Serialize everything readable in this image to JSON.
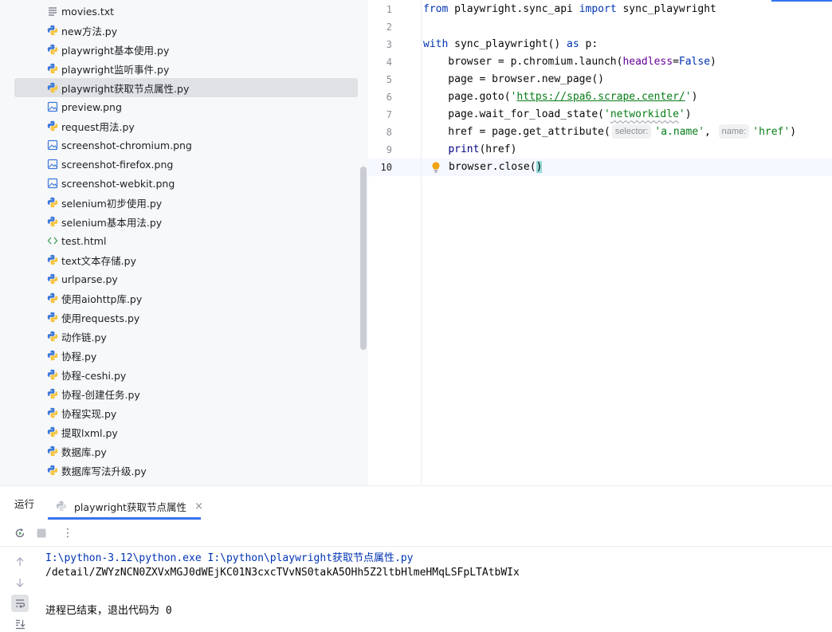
{
  "project_tree": {
    "items": [
      {
        "name": "movies.txt",
        "type": "text"
      },
      {
        "name": "new方法.py",
        "type": "python"
      },
      {
        "name": "playwright基本使用.py",
        "type": "python"
      },
      {
        "name": "playwright监听事件.py",
        "type": "python"
      },
      {
        "name": "playwright获取节点属性.py",
        "type": "python",
        "selected": true
      },
      {
        "name": "preview.png",
        "type": "image"
      },
      {
        "name": "request用法.py",
        "type": "python"
      },
      {
        "name": "screenshot-chromium.png",
        "type": "image"
      },
      {
        "name": "screenshot-firefox.png",
        "type": "image"
      },
      {
        "name": "screenshot-webkit.png",
        "type": "image"
      },
      {
        "name": "selenium初步使用.py",
        "type": "python"
      },
      {
        "name": "selenium基本用法.py",
        "type": "python"
      },
      {
        "name": "test.html",
        "type": "html"
      },
      {
        "name": "text文本存储.py",
        "type": "python"
      },
      {
        "name": "urlparse.py",
        "type": "python"
      },
      {
        "name": "使用aiohttp库.py",
        "type": "python"
      },
      {
        "name": "使用requests.py",
        "type": "python"
      },
      {
        "name": "动作链.py",
        "type": "python"
      },
      {
        "name": "协程.py",
        "type": "python"
      },
      {
        "name": "协程-ceshi.py",
        "type": "python"
      },
      {
        "name": "协程-创建任务.py",
        "type": "python"
      },
      {
        "name": "协程实现.py",
        "type": "python"
      },
      {
        "name": "提取lxml.py",
        "type": "python"
      },
      {
        "name": "数据库.py",
        "type": "python"
      },
      {
        "name": "数据库写法升级.py",
        "type": "python"
      }
    ]
  },
  "editor": {
    "current_line": 10,
    "line_numbers": [
      "1",
      "2",
      "3",
      "4",
      "5",
      "6",
      "7",
      "8",
      "9",
      "10"
    ],
    "tokens": {
      "l1_from": "from",
      "l1_module": " playwright.sync_api ",
      "l1_import": "import",
      "l1_name": " sync_playwright",
      "l3_with": "with",
      "l3_call": " sync_playwright() ",
      "l3_as": "as",
      "l3_rest": " p:",
      "l4_pre": "    browser = p.chromium.launch(",
      "l4_param": "headless",
      "l4_eq": "=",
      "l4_false": "False",
      "l4_end": ")",
      "l5": "    page = browser.new_page()",
      "l6_pre": "    page.goto(",
      "l6_q1": "'",
      "l6_url": "https://spa6.scrape.center/",
      "l6_q2": "'",
      "l6_end": ")",
      "l7_pre": "    page.wait_for_load_state(",
      "l7_q1": "'",
      "l7_str": "networkidle",
      "l7_q2": "'",
      "l7_end": ")",
      "l8_pre": "    href = page.get_attribute(",
      "l8_hint1": "selector:",
      "l8_str1": "'a.name'",
      "l8_comma": ", ",
      "l8_hint2": "name:",
      "l8_str2": "'href'",
      "l8_end": ")",
      "l9_indent": "    ",
      "l9_print": "print",
      "l9_rest": "(href)",
      "l10_pre": "browser.close(",
      "l10_paren": ")"
    }
  },
  "run_panel": {
    "title": "运行",
    "tab_label": "playwright获取节点属性",
    "tab_close": "×",
    "toolbar": {
      "rerun_icon": "rerun-icon",
      "stop_icon": "stop-icon",
      "more_label": "⋮"
    },
    "console": {
      "command": "I:\\python-3.12\\python.exe I:\\python\\playwright获取节点属性.py",
      "output": "/detail/ZWYzNCN0ZXVxMGJ0dWEjKC01N3cxcTVvNS0takA5OHh5Z2ltbHlmeHMqLSFpLTAtbWIx",
      "exit_message": "进程已结束，退出代码为 0"
    }
  },
  "colors": {
    "keyword": "#0033b3",
    "string": "#067d17",
    "accent": "#3574f0",
    "selection": "#dfe1e5"
  }
}
